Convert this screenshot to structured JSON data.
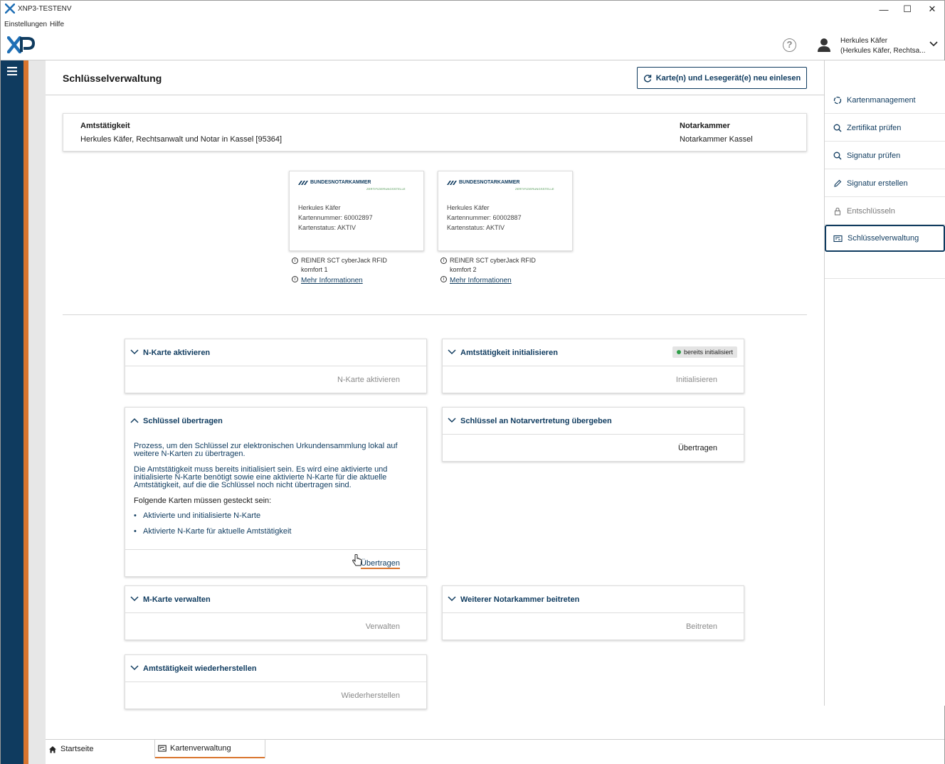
{
  "window": {
    "title": "XNP3-TESTENV",
    "minimize": "—",
    "maximize": "☐",
    "close": "✕"
  },
  "menu": [
    "Einstellungen",
    "Hilfe"
  ],
  "header": {
    "help": "?",
    "user_name": "Herkules Käfer",
    "user_sub": "(Herkules Käfer, Rechtsa..."
  },
  "page": {
    "title": "Schlüsselverwaltung",
    "reload_button": "Karte(n) und Lesegerät(e) neu einlesen"
  },
  "info": {
    "office_label": "Amtstätigkeit",
    "office_value": "Herkules Käfer, Rechtsanwalt und Notar in Kassel [95364]",
    "chamber_label": "Notarkammer",
    "chamber_value": "Notarkammer Kassel"
  },
  "cards": [
    {
      "brand": "BUNDESNOTARKAMMER",
      "brand_sub": "ZERTIFIZIERUNGSSTELLE",
      "holder": "Herkules Käfer",
      "number": "Kartennummer: 60002897",
      "status": "Kartenstatus: AKTIV",
      "reader_line1": "REINER SCT cyberJack RFID",
      "reader_line2": "komfort 1",
      "more": "Mehr Informationen"
    },
    {
      "brand": "BUNDESNOTARKAMMER",
      "brand_sub": "ZERTIFIZIERUNGSSTELLE",
      "holder": "Herkules Käfer",
      "number": "Kartennummer: 60002887",
      "status": "Kartenstatus: AKTIV",
      "reader_line1": "REINER SCT cyberJack RFID",
      "reader_line2": "komfort 2",
      "more": "Mehr Informationen"
    }
  ],
  "panels": {
    "n_karte": {
      "title": "N-Karte aktivieren",
      "action": "N-Karte aktivieren"
    },
    "init": {
      "title": "Amtstätigkeit initialisieren",
      "badge": "bereits initialisiert",
      "action": "Initialisieren"
    },
    "transfer": {
      "title": "Schlüssel übertragen",
      "p1": "Prozess, um den Schlüssel zur elektronischen Urkundensammlung lokal auf weitere N-Karten zu übertragen.",
      "p2": "Die Amtstätigkeit muss bereits initialisiert sein. Es wird eine aktivierte und initialisierte N-Karte benötigt sowie eine aktivierte N-Karte für die aktuelle Amtstätigkeit, auf die die Schlüssel noch nicht übertragen sind.",
      "req": "Folgende Karten müssen gesteckt sein:",
      "items": [
        "Aktivierte und initialisierte N-Karte",
        "Aktivierte N-Karte für aktuelle Amtstätigkeit"
      ],
      "action": "Übertragen"
    },
    "vertretung": {
      "title": "Schlüssel an Notarvertretung übergeben",
      "action": "Übertragen"
    },
    "m_karte": {
      "title": "M-Karte verwalten",
      "action": "Verwalten"
    },
    "kammer": {
      "title": "Weiterer Notarkammer beitreten",
      "action": "Beitreten"
    },
    "restore": {
      "title": "Amtstätigkeit wiederherstellen",
      "action": "Wiederherstellen"
    }
  },
  "sidebar": [
    {
      "label": "Kartenmanagement",
      "icon": "card-management-icon"
    },
    {
      "label": "Zertifikat prüfen",
      "icon": "search-icon"
    },
    {
      "label": "Signatur prüfen",
      "icon": "search-icon"
    },
    {
      "label": "Signatur erstellen",
      "icon": "pencil-icon"
    },
    {
      "label": "Entschlüsseln",
      "icon": "lock-icon"
    },
    {
      "label": "Schlüsselverwaltung",
      "icon": "key-management-icon"
    }
  ],
  "tabs": [
    {
      "label": "Startseite",
      "icon": "home-icon"
    },
    {
      "label": "Kartenverwaltung",
      "icon": "card-icon"
    }
  ],
  "colors": {
    "brand_navy": "#0f3b5f",
    "accent_orange": "#d9752e",
    "status_green": "#2e9e48"
  }
}
